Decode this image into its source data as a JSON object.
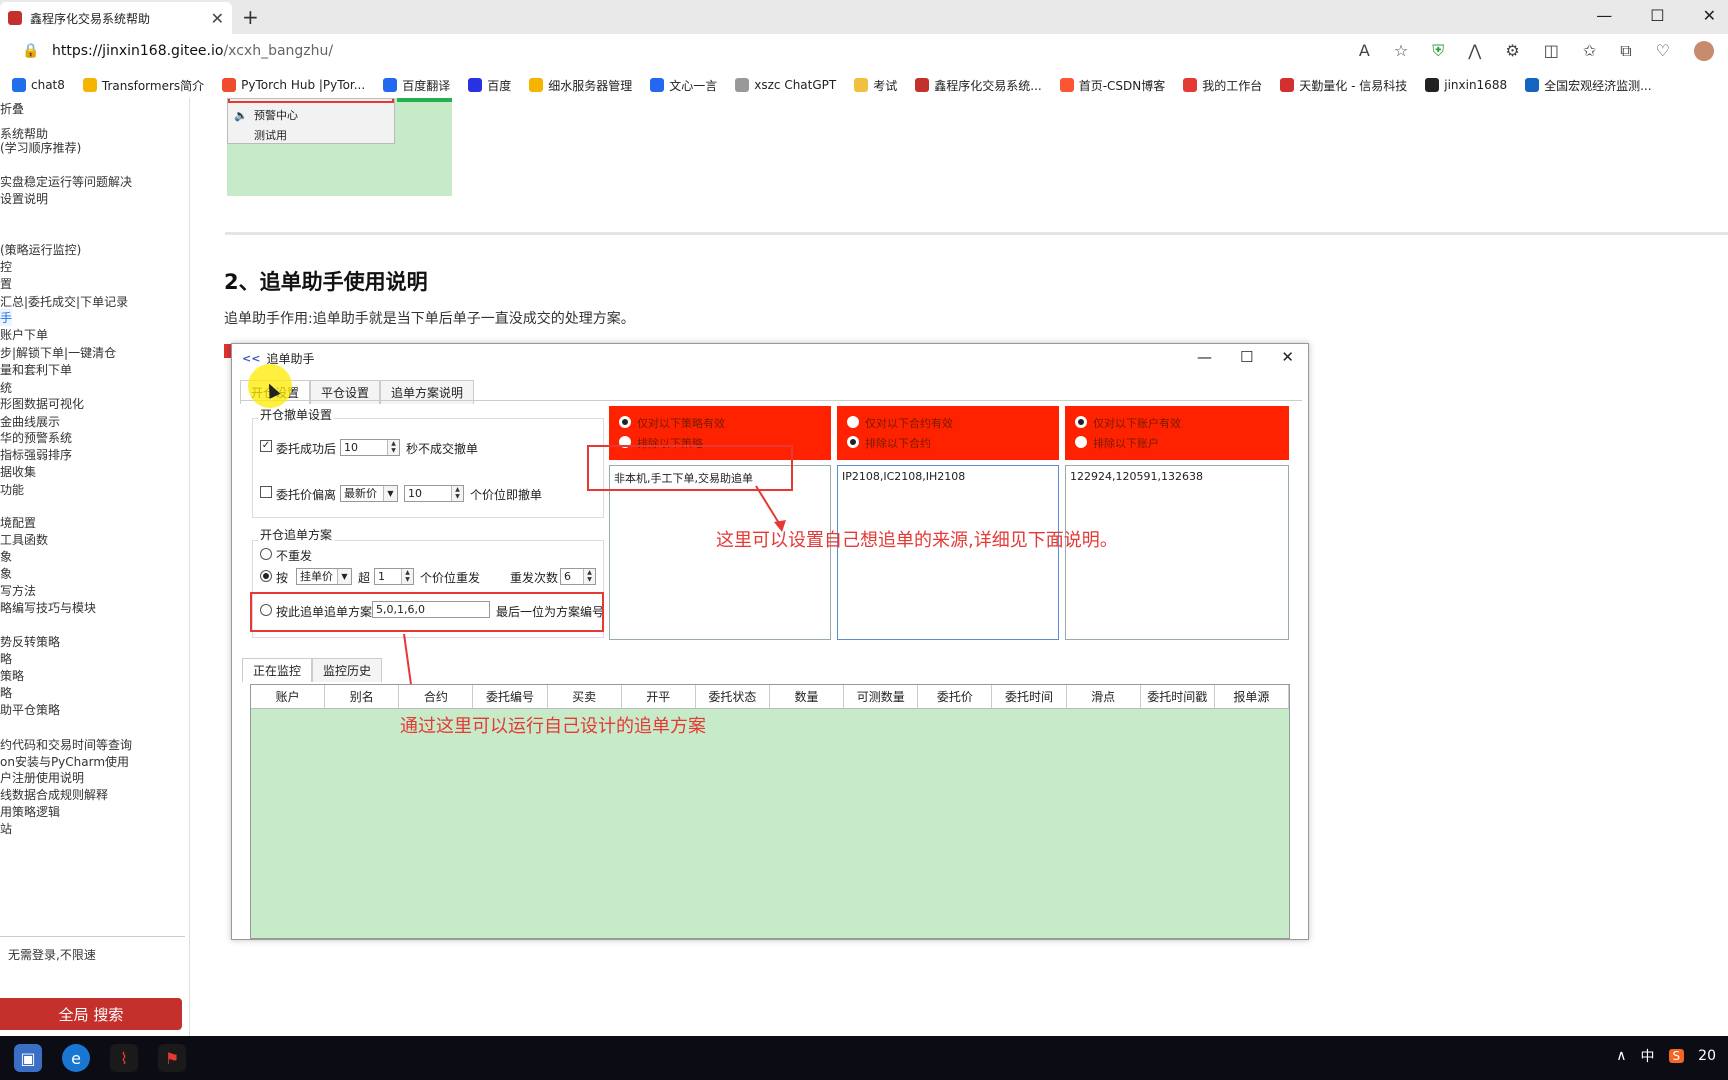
{
  "browser": {
    "tab_title": "鑫程序化交易系统帮助",
    "tab_close": "✕",
    "new_tab": "+",
    "url_host": "https://jinxin168.gitee.io",
    "url_path": "/xcxh_bangzhu/",
    "bookmarks": [
      {
        "label": "chat8",
        "color": "#1f6feb"
      },
      {
        "label": "Transformers简介",
        "color": "#f5b400"
      },
      {
        "label": "PyTorch Hub |PyTor...",
        "color": "#ee4c2c"
      },
      {
        "label": "百度翻译",
        "color": "#2468f2"
      },
      {
        "label": "百度",
        "color": "#2932e1"
      },
      {
        "label": "细水服务器管理",
        "color": "#f4b400"
      },
      {
        "label": "文心一言",
        "color": "#2468f2"
      },
      {
        "label": "xszc ChatGPT",
        "color": "#999999"
      },
      {
        "label": "考试",
        "color": "#f0c040"
      },
      {
        "label": "鑫程序化交易系统...",
        "color": "#c4302b"
      },
      {
        "label": "首页-CSDN博客",
        "color": "#fc5531"
      },
      {
        "label": "我的工作台",
        "color": "#e53935"
      },
      {
        "label": "天勤量化 - 信易科技",
        "color": "#d32f2f"
      },
      {
        "label": "jinxin1688",
        "color": "#222222"
      },
      {
        "label": "全国宏观经济监测...",
        "color": "#1565c0"
      }
    ]
  },
  "sidebar": {
    "items": [
      "折叠",
      "系统帮助",
      "(学习顺序推荐)",
      "实盘稳定运行等问题解决",
      "设置说明",
      "(策略运行监控)",
      "控",
      "置",
      "汇总|委托成交|下单记录",
      "手",
      "账户下单",
      "步|解锁下单|一键清仓",
      "量和套利下单",
      "统",
      "形图数据可视化",
      "金曲线展示",
      "华的预警系统",
      "指标强弱排序",
      "据收集",
      "功能",
      "境配置",
      "工具函数",
      "象",
      "象",
      "写方法",
      "略编写技巧与模块",
      "势反转策略",
      "略",
      "策略",
      "略",
      "助平仓策略",
      "约代码和交易时间等查询",
      "on安装与PyCharm使用",
      "户注册使用说明",
      "线数据合成规则解释",
      "用策略逻辑",
      "站"
    ],
    "note": "无需登录,不限速",
    "search_button": "全局 搜索"
  },
  "article": {
    "menu_items": [
      "预警中心",
      "测试用"
    ],
    "heading": "2、追单助手使用说明",
    "paragraph": "追单助手作用:追单助手就是当下单后单子一直没成交的处理方案。"
  },
  "app": {
    "title": "追单助手",
    "title_icon": "<<",
    "tabs": [
      "开仓设置",
      "平仓设置",
      "追单方案说明"
    ],
    "group1_title": "开仓撤单设置",
    "cancel_after_label": "委托成功后",
    "cancel_after_value": "10",
    "cancel_after_suffix": "秒不成交撤单",
    "deviation_label": "委托价偏离",
    "deviation_combo": "最新价",
    "deviation_value": "10",
    "deviation_suffix": "个价位即撤单",
    "group2_title": "开仓追单方案",
    "opt_no_resend": "不重发",
    "opt_by": "按",
    "by_combo": "挂单价",
    "over_label": "超",
    "over_value": "1",
    "over_suffix": "个价位重发",
    "resend_label": "重发次数",
    "resend_value": "6",
    "opt_scheme": "按此追单追单方案",
    "scheme_value": "5,0,1,6,0",
    "scheme_suffix": "最后一位为方案编号",
    "panel1": {
      "opt1": "仅对以下策略有效",
      "opt2": "排除以下策略",
      "text": "非本机,手工下单,交易助追单"
    },
    "panel2": {
      "opt1": "仅对以下合约有效",
      "opt2": "排除以下合约",
      "text": "IP2108,IC2108,IH2108"
    },
    "panel3": {
      "opt1": "仅对以下账户有效",
      "opt2": "排除以下账户",
      "text": "122924,120591,132638"
    },
    "annotation1": "这里可以设置自己想追单的来源,详细见下面说明。",
    "annotation2": "通过这里可以运行自己设计的追单方案",
    "monitor_tabs": [
      "正在监控",
      "监控历史"
    ],
    "columns": [
      "账户",
      "别名",
      "合约",
      "委托编号",
      "买卖",
      "开平",
      "委托状态",
      "数量",
      "可测数量",
      "委托价",
      "委托时间",
      "滑点",
      "委托时间戳",
      "报单源"
    ]
  },
  "taskbar": {
    "tray_ime": "中",
    "tray_up": "∧",
    "tray_time": "20"
  }
}
